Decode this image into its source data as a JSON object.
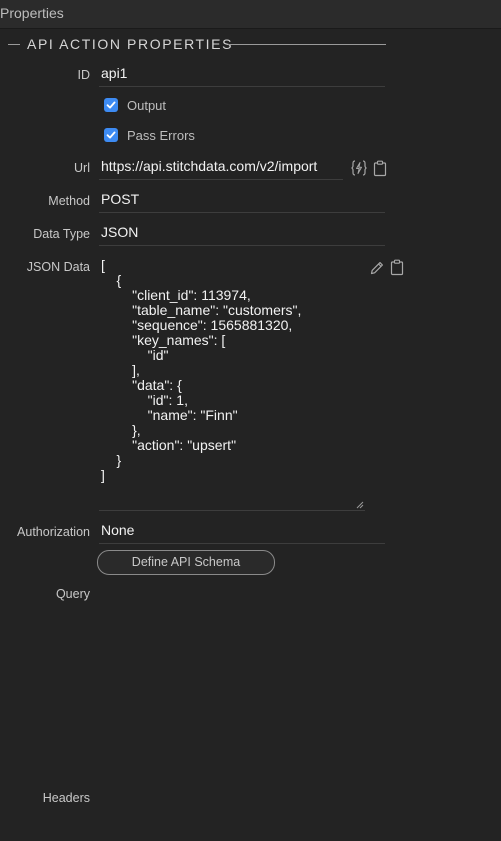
{
  "panel": {
    "title": "Properties"
  },
  "section": {
    "title": "API ACTION PROPERTIES"
  },
  "fields": {
    "id": {
      "label": "ID",
      "value": "api1"
    },
    "output": {
      "label": "Output",
      "checked": true
    },
    "pass_errors": {
      "label": "Pass Errors",
      "checked": true
    },
    "url": {
      "label": "Url",
      "value": "https://api.stitchdata.com/v2/import"
    },
    "method": {
      "label": "Method",
      "value": "POST"
    },
    "data_type": {
      "label": "Data Type",
      "value": "JSON"
    },
    "json_data": {
      "label": "JSON Data",
      "value": "[\n    {\n        \"client_id\": 113974,\n        \"table_name\": \"customers\",\n        \"sequence\": 1565881320,\n        \"key_names\": [\n            \"id\"\n        ],\n        \"data\": {\n            \"id\": 1,\n            \"name\": \"Finn\"\n        },\n        \"action\": \"upsert\"\n    }\n]"
    },
    "authorization": {
      "label": "Authorization",
      "value": "None"
    },
    "query": {
      "label": "Query"
    },
    "headers": {
      "label": "Headers"
    }
  },
  "buttons": {
    "define_schema": "Define API Schema"
  },
  "icons": {
    "url_dynamic": "dynamic-data-icon",
    "url_clipboard": "clipboard-icon",
    "json_edit": "pencil-icon",
    "json_clipboard": "clipboard-icon"
  },
  "colors": {
    "checkbox": "#3d8bf3",
    "background": "#232323"
  }
}
